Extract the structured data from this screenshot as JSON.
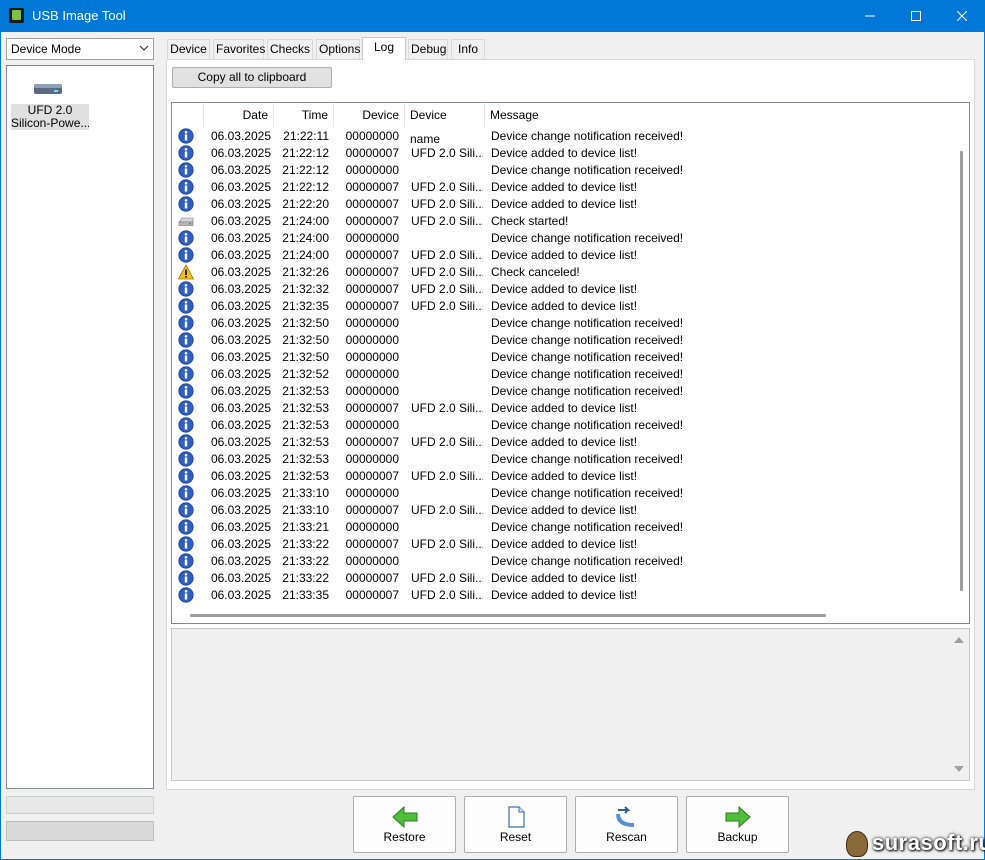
{
  "window": {
    "title": "USB Image Tool",
    "accent": "#0078d7"
  },
  "sidebar": {
    "mode_select": "Device Mode",
    "device": {
      "line1": "UFD 2.0",
      "line2": "Silicon-Powe..."
    }
  },
  "tabs": [
    {
      "label": "Device"
    },
    {
      "label": "Favorites"
    },
    {
      "label": "Checks"
    },
    {
      "label": "Options"
    },
    {
      "label": "Log",
      "active": true
    },
    {
      "label": "Debug"
    },
    {
      "label": "Info"
    }
  ],
  "log": {
    "copy_label": "Copy all to clipboard",
    "columns": [
      "Date",
      "Time",
      "Device",
      "Device name",
      "Message"
    ],
    "rows": [
      {
        "icon": "info",
        "date": "06.03.2025",
        "time": "21:22:11",
        "device": "00000000",
        "name": "",
        "message": "Device change notification received!"
      },
      {
        "icon": "info",
        "date": "06.03.2025",
        "time": "21:22:12",
        "device": "00000007",
        "name": "UFD 2.0 Sili...",
        "message": "Device added to device list!"
      },
      {
        "icon": "info",
        "date": "06.03.2025",
        "time": "21:22:12",
        "device": "00000000",
        "name": "",
        "message": "Device change notification received!"
      },
      {
        "icon": "info",
        "date": "06.03.2025",
        "time": "21:22:12",
        "device": "00000007",
        "name": "UFD 2.0 Sili...",
        "message": "Device added to device list!"
      },
      {
        "icon": "info",
        "date": "06.03.2025",
        "time": "21:22:20",
        "device": "00000007",
        "name": "UFD 2.0 Sili...",
        "message": "Device added to device list!"
      },
      {
        "icon": "drive",
        "date": "06.03.2025",
        "time": "21:24:00",
        "device": "00000007",
        "name": "UFD 2.0 Sili...",
        "message": "Check started!"
      },
      {
        "icon": "info",
        "date": "06.03.2025",
        "time": "21:24:00",
        "device": "00000000",
        "name": "",
        "message": "Device change notification received!"
      },
      {
        "icon": "info",
        "date": "06.03.2025",
        "time": "21:24:00",
        "device": "00000007",
        "name": "UFD 2.0 Sili...",
        "message": "Device added to device list!"
      },
      {
        "icon": "warning",
        "date": "06.03.2025",
        "time": "21:32:26",
        "device": "00000007",
        "name": "UFD 2.0 Sili...",
        "message": "Check canceled!"
      },
      {
        "icon": "info",
        "date": "06.03.2025",
        "time": "21:32:32",
        "device": "00000007",
        "name": "UFD 2.0 Sili...",
        "message": "Device added to device list!"
      },
      {
        "icon": "info",
        "date": "06.03.2025",
        "time": "21:32:35",
        "device": "00000007",
        "name": "UFD 2.0 Sili...",
        "message": "Device added to device list!"
      },
      {
        "icon": "info",
        "date": "06.03.2025",
        "time": "21:32:50",
        "device": "00000000",
        "name": "",
        "message": "Device change notification received!"
      },
      {
        "icon": "info",
        "date": "06.03.2025",
        "time": "21:32:50",
        "device": "00000000",
        "name": "",
        "message": "Device change notification received!"
      },
      {
        "icon": "info",
        "date": "06.03.2025",
        "time": "21:32:50",
        "device": "00000000",
        "name": "",
        "message": "Device change notification received!"
      },
      {
        "icon": "info",
        "date": "06.03.2025",
        "time": "21:32:52",
        "device": "00000000",
        "name": "",
        "message": "Device change notification received!"
      },
      {
        "icon": "info",
        "date": "06.03.2025",
        "time": "21:32:53",
        "device": "00000000",
        "name": "",
        "message": "Device change notification received!"
      },
      {
        "icon": "info",
        "date": "06.03.2025",
        "time": "21:32:53",
        "device": "00000007",
        "name": "UFD 2.0 Sili...",
        "message": "Device added to device list!"
      },
      {
        "icon": "info",
        "date": "06.03.2025",
        "time": "21:32:53",
        "device": "00000000",
        "name": "",
        "message": "Device change notification received!"
      },
      {
        "icon": "info",
        "date": "06.03.2025",
        "time": "21:32:53",
        "device": "00000007",
        "name": "UFD 2.0 Sili...",
        "message": "Device added to device list!"
      },
      {
        "icon": "info",
        "date": "06.03.2025",
        "time": "21:32:53",
        "device": "00000000",
        "name": "",
        "message": "Device change notification received!"
      },
      {
        "icon": "info",
        "date": "06.03.2025",
        "time": "21:32:53",
        "device": "00000007",
        "name": "UFD 2.0 Sili...",
        "message": "Device added to device list!"
      },
      {
        "icon": "info",
        "date": "06.03.2025",
        "time": "21:33:10",
        "device": "00000000",
        "name": "",
        "message": "Device change notification received!"
      },
      {
        "icon": "info",
        "date": "06.03.2025",
        "time": "21:33:10",
        "device": "00000007",
        "name": "UFD 2.0 Sili...",
        "message": "Device added to device list!"
      },
      {
        "icon": "info",
        "date": "06.03.2025",
        "time": "21:33:21",
        "device": "00000000",
        "name": "",
        "message": "Device change notification received!"
      },
      {
        "icon": "info",
        "date": "06.03.2025",
        "time": "21:33:22",
        "device": "00000007",
        "name": "UFD 2.0 Sili...",
        "message": "Device added to device list!"
      },
      {
        "icon": "info",
        "date": "06.03.2025",
        "time": "21:33:22",
        "device": "00000000",
        "name": "",
        "message": "Device change notification received!"
      },
      {
        "icon": "info",
        "date": "06.03.2025",
        "time": "21:33:22",
        "device": "00000007",
        "name": "UFD 2.0 Sili...",
        "message": "Device added to device list!"
      },
      {
        "icon": "info",
        "date": "06.03.2025",
        "time": "21:33:35",
        "device": "00000007",
        "name": "UFD 2.0 Sili...",
        "message": "Device added to device list!"
      }
    ]
  },
  "actions": {
    "restore": "Restore",
    "reset": "Reset",
    "rescan": "Rescan",
    "backup": "Backup"
  },
  "watermark": "surasoft.ru"
}
